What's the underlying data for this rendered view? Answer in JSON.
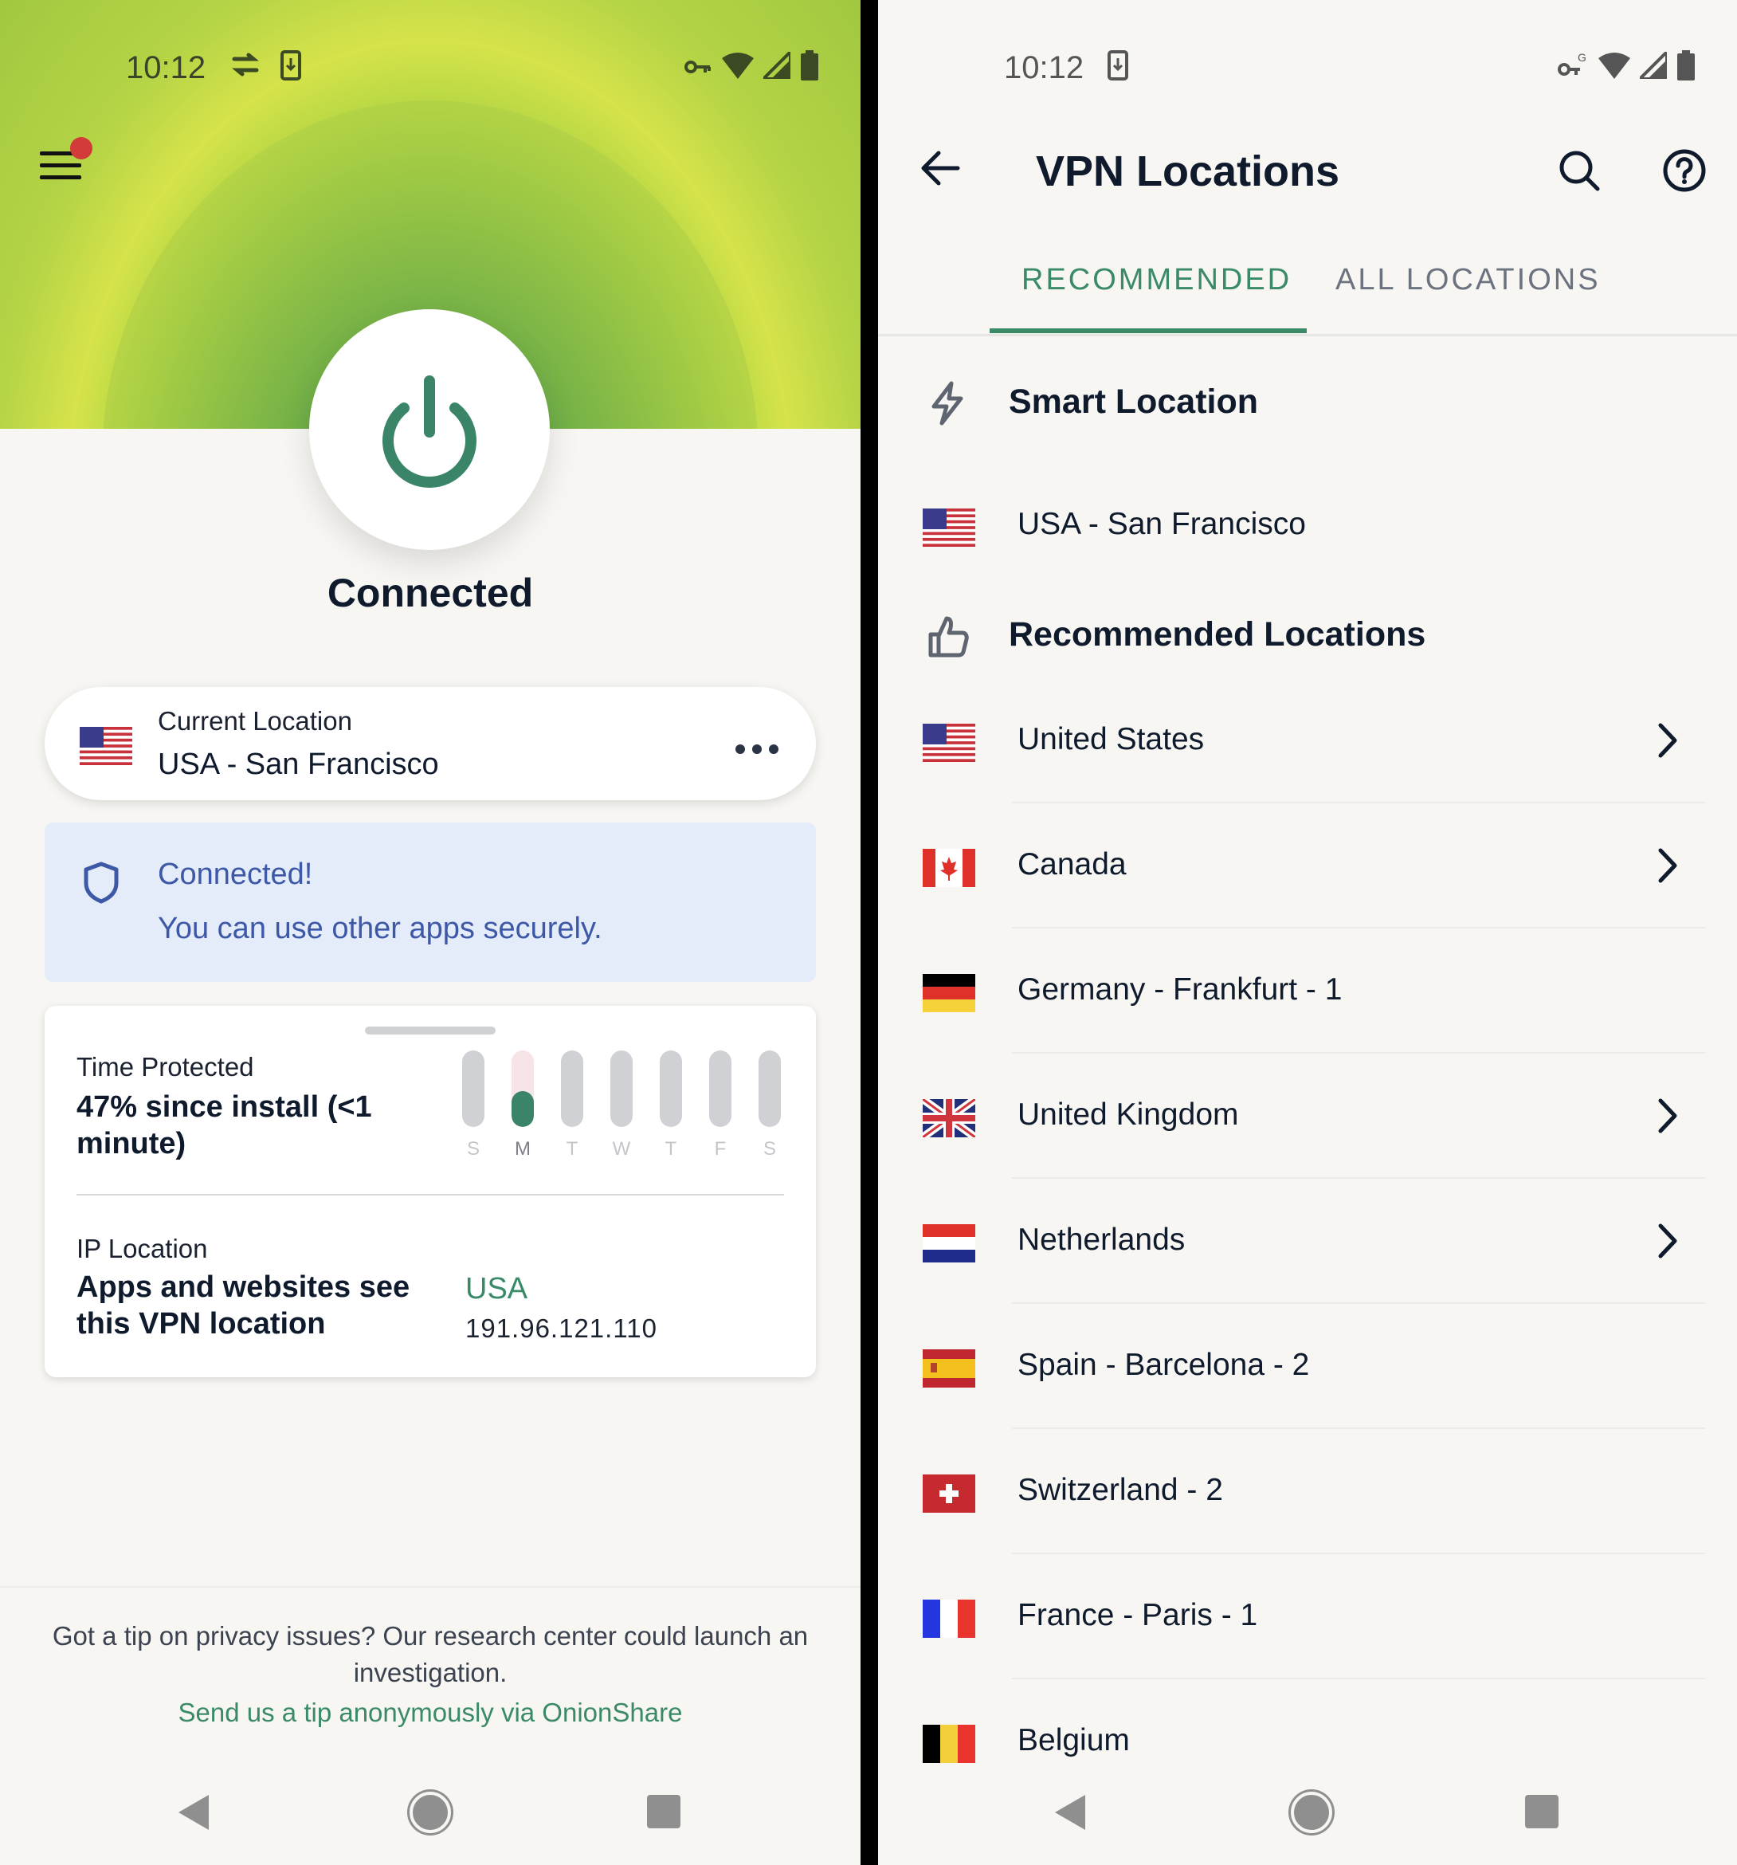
{
  "left_screen": {
    "status_bar": {
      "time": "10:12",
      "left_icons": [
        "cast-icon",
        "download-icon"
      ],
      "right_icons": [
        "vpn-key-icon",
        "wifi-icon",
        "signal-icon",
        "battery-icon"
      ]
    },
    "menu": {
      "icon": "hamburger-menu-icon",
      "has_notification_dot": true
    },
    "power_button": {
      "icon": "power-icon",
      "state": "on"
    },
    "connection_status": "Connected",
    "current_location": {
      "label": "Current Location",
      "value": "USA - San Francisco",
      "flag": "us",
      "more_icon": "more-horizontal-icon"
    },
    "notice": {
      "icon": "shield-icon",
      "title": "Connected!",
      "message": "You can use other apps securely."
    },
    "stats": {
      "time_protected_label": "Time Protected",
      "time_protected_value": "47% since install (<1 minute)",
      "week": [
        {
          "day": "S",
          "fraction": 0,
          "active": false
        },
        {
          "day": "M",
          "fraction": 0.47,
          "active": true
        },
        {
          "day": "T",
          "fraction": 0,
          "active": false
        },
        {
          "day": "W",
          "fraction": 0,
          "active": false
        },
        {
          "day": "T",
          "fraction": 0,
          "active": false
        },
        {
          "day": "F",
          "fraction": 0,
          "active": false
        },
        {
          "day": "S",
          "fraction": 0,
          "active": false
        }
      ],
      "ip_label": "IP Location",
      "ip_description": "Apps and websites see this VPN location",
      "ip_country": "USA",
      "ip_address": "191.96.121.110"
    },
    "tip": {
      "text": "Got a tip on privacy issues? Our research center could launch an investigation.",
      "link": "Send us a tip anonymously via OnionShare"
    }
  },
  "right_screen": {
    "status_bar": {
      "time": "10:12",
      "left_icons": [
        "download-icon"
      ],
      "right_icons": [
        "vpn-key-icon",
        "wifi-icon",
        "signal-icon",
        "battery-icon"
      ]
    },
    "app_bar": {
      "title": "VPN Locations"
    },
    "tabs": [
      {
        "label": "RECOMMENDED",
        "selected": true
      },
      {
        "label": "ALL LOCATIONS",
        "selected": false
      }
    ],
    "smart_location": {
      "heading": "Smart Location",
      "item": {
        "name": "USA - San Francisco",
        "flag": "us"
      }
    },
    "recommended": {
      "heading": "Recommended Locations",
      "items": [
        {
          "name": "United States",
          "flag": "us",
          "expandable": true
        },
        {
          "name": "Canada",
          "flag": "ca",
          "expandable": true
        },
        {
          "name": "Germany - Frankfurt - 1",
          "flag": "de",
          "expandable": false
        },
        {
          "name": "United Kingdom",
          "flag": "gb",
          "expandable": true
        },
        {
          "name": "Netherlands",
          "flag": "nl",
          "expandable": true
        },
        {
          "name": "Spain - Barcelona - 2",
          "flag": "es",
          "expandable": false
        },
        {
          "name": "Switzerland - 2",
          "flag": "ch",
          "expandable": false
        },
        {
          "name": "France - Paris - 1",
          "flag": "fr",
          "expandable": false
        },
        {
          "name": "Belgium",
          "flag": "be",
          "expandable": false
        }
      ]
    }
  },
  "nav_bar": [
    "back-icon",
    "home-icon",
    "recents-icon"
  ],
  "colors": {
    "accent_green": "#3a8a68",
    "notice_blue": "#3e58a8",
    "notice_bg": "#e3ecf8",
    "background": "#f7f6f2",
    "menu_dot": "#d33a3a"
  }
}
